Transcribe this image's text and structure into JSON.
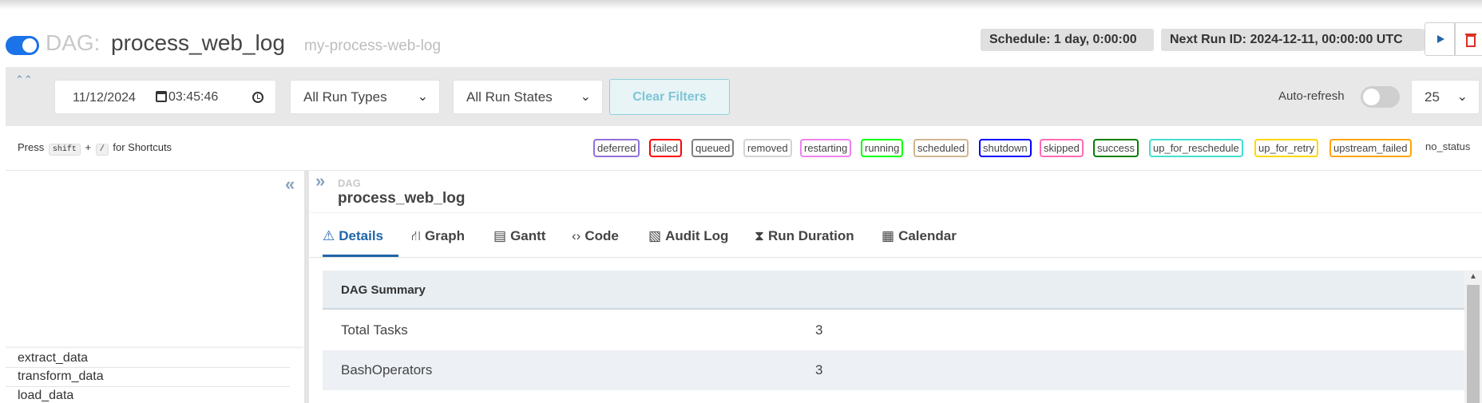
{
  "header": {
    "dag_prefix": "DAG:",
    "dag_id": "process_web_log",
    "dag_display_name": "my-process-web-log",
    "schedule": "Schedule: 1 day, 0:00:00",
    "next_run": "Next Run ID: 2024-12-11, 00:00:00 UTC",
    "paused_toggle_on": true
  },
  "filters": {
    "date": "11/12/2024",
    "time": "03:45:46",
    "run_types": "All Run Types",
    "run_states": "All Run States",
    "clear_label": "Clear Filters",
    "autorefresh_label": "Auto-refresh",
    "page_size": "25"
  },
  "shortcuts": {
    "press": "Press",
    "key1": "shift",
    "plus": "+",
    "key2": "/",
    "for": "for Shortcuts"
  },
  "legend": [
    {
      "label": "deferred",
      "color": "#9370db"
    },
    {
      "label": "failed",
      "color": "#ff0000"
    },
    {
      "label": "queued",
      "color": "#808080"
    },
    {
      "label": "removed",
      "color": "#d3d3d3"
    },
    {
      "label": "restarting",
      "color": "#ee82ee"
    },
    {
      "label": "running",
      "color": "#00ff00"
    },
    {
      "label": "scheduled",
      "color": "#d2b48c"
    },
    {
      "label": "shutdown",
      "color": "#0000ff"
    },
    {
      "label": "skipped",
      "color": "#ff69b4"
    },
    {
      "label": "success",
      "color": "#008000"
    },
    {
      "label": "up_for_reschedule",
      "color": "#40e0d0"
    },
    {
      "label": "up_for_retry",
      "color": "#ffd700"
    },
    {
      "label": "upstream_failed",
      "color": "#ffa500"
    },
    {
      "label": "no_status",
      "color": "#ffffff"
    }
  ],
  "tasks": [
    "extract_data",
    "transform_data",
    "load_data"
  ],
  "detail": {
    "kind": "DAG",
    "name": "process_web_log"
  },
  "tabs": [
    {
      "label": "Details",
      "icon": "warning-icon",
      "glyph": "⚠"
    },
    {
      "label": "Graph",
      "icon": "graph-icon",
      "glyph": "⛙"
    },
    {
      "label": "Gantt",
      "icon": "gantt-icon",
      "glyph": "▤"
    },
    {
      "label": "Code",
      "icon": "code-icon",
      "glyph": "‹›"
    },
    {
      "label": "Audit Log",
      "icon": "audit-log-icon",
      "glyph": "▧"
    },
    {
      "label": "Run Duration",
      "icon": "hourglass-icon",
      "glyph": "⧗"
    },
    {
      "label": "Calendar",
      "icon": "calendar-icon",
      "glyph": "▦"
    }
  ],
  "summary": {
    "title": "DAG Summary",
    "rows": [
      {
        "key": "Total Tasks",
        "value": "3"
      },
      {
        "key": "BashOperators",
        "value": "3"
      }
    ]
  }
}
